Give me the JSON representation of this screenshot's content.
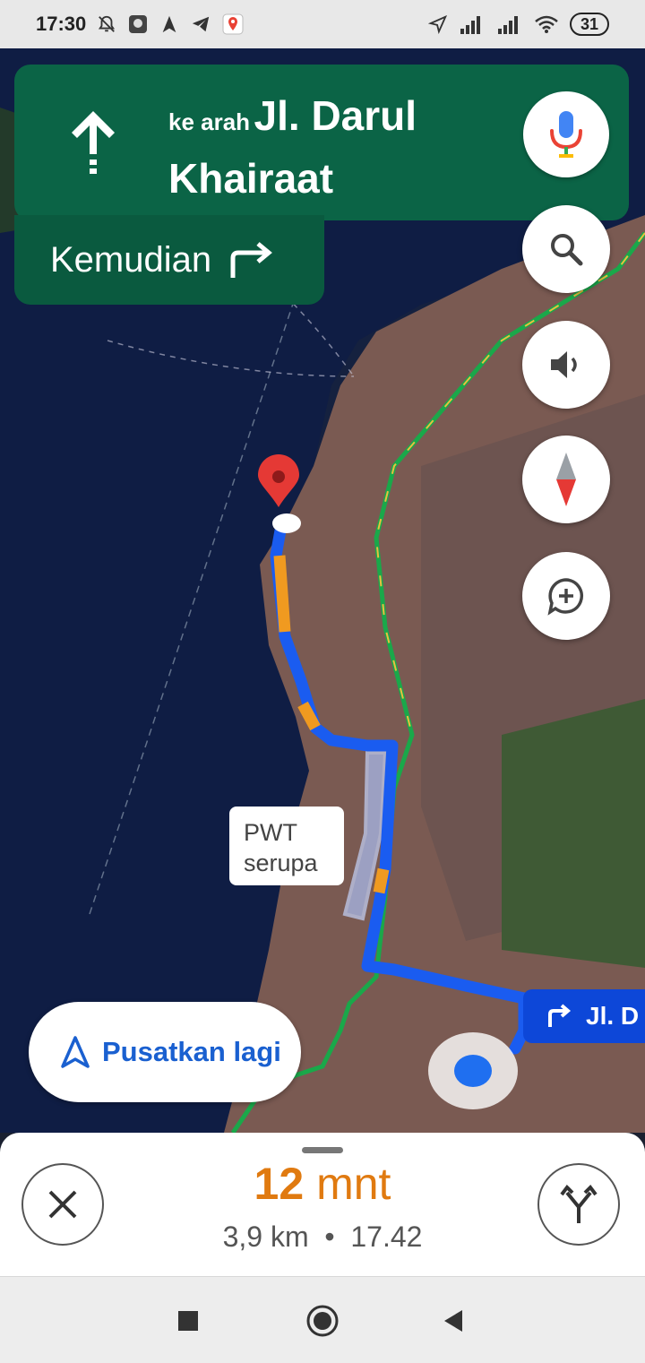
{
  "status_bar": {
    "time": "17:30",
    "battery": "31",
    "icons": [
      "bell-off-icon",
      "app-icon",
      "navigation-icon",
      "telegram-icon",
      "maps-icon",
      "location-icon",
      "signal-icon",
      "signal-icon",
      "wifi-icon"
    ]
  },
  "navigation": {
    "direction_icon": "arrow-up-icon",
    "prefix": "ke arah",
    "street": "Jl. Darul Khairaat",
    "then_label": "Kemudian",
    "then_icon": "turn-right-icon"
  },
  "map": {
    "alt_route_label_line1": "PWT",
    "alt_route_label_line2": "serupa",
    "route_chip": "Jl. D",
    "route_chip_icon": "turn-right-icon",
    "recenter_label": "Pusatkan lagi",
    "colors": {
      "route": "#1a5cf0",
      "traffic_slow": "#f09a20",
      "alt_route": "#a8b8e8"
    }
  },
  "controls": [
    "mic-icon",
    "search-icon",
    "volume-icon",
    "compass-icon",
    "add-report-icon"
  ],
  "trip": {
    "eta_minutes": "12",
    "eta_unit": "mnt",
    "distance": "3,9 km",
    "separator": "•",
    "arrival": "17.42"
  },
  "system_nav": [
    "recent-apps",
    "home",
    "back"
  ]
}
